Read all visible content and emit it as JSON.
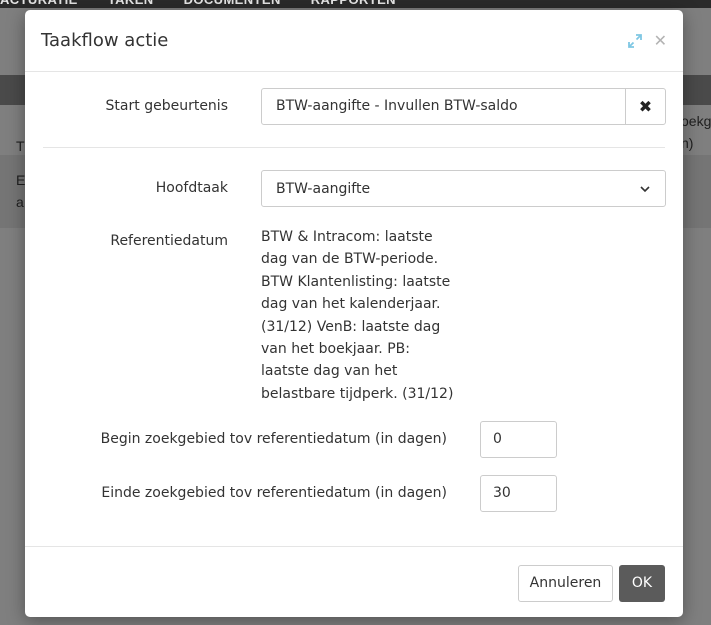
{
  "background": {
    "nav_items": [
      "ACTURATIE",
      "TAKEN",
      "DOCUMENTEN",
      "RAPPORTEN"
    ],
    "right_fragments": [
      "oekg",
      "n)"
    ],
    "left_fragments": [
      "T",
      "E",
      "a"
    ]
  },
  "modal": {
    "title": "Taakflow actie",
    "start_label": "Start gebeurtenis",
    "start_value": "BTW-aangifte - Invullen BTW-saldo",
    "hoofdtaak_label": "Hoofdtaak",
    "hoofdtaak_value": "BTW-aangifte",
    "referentiedatum_label": "Referentiedatum",
    "referentiedatum_text": "BTW & Intracom: laatste dag van de BTW-periode. BTW Klantenlisting: laatste dag van het kalenderjaar. (31/12) VenB: laatste dag van het boekjaar. PB: laatste dag van het belastbare tijdperk. (31/12)",
    "begin_label": "Begin zoekgebied tov referentiedatum (in dagen)",
    "begin_value": "0",
    "einde_label": "Einde zoekgebied tov referentiedatum (in dagen)",
    "einde_value": "30",
    "cancel_label": "Annuleren",
    "ok_label": "OK"
  },
  "colors": {
    "overlay": "#7f7f7f",
    "primary_button": "#5b5b5b",
    "expand_icon": "#7fc7e3"
  },
  "icons": {
    "expand": "expand-icon",
    "close": "close-icon",
    "clear": "times-icon",
    "chevron": "chevron-down-icon"
  }
}
